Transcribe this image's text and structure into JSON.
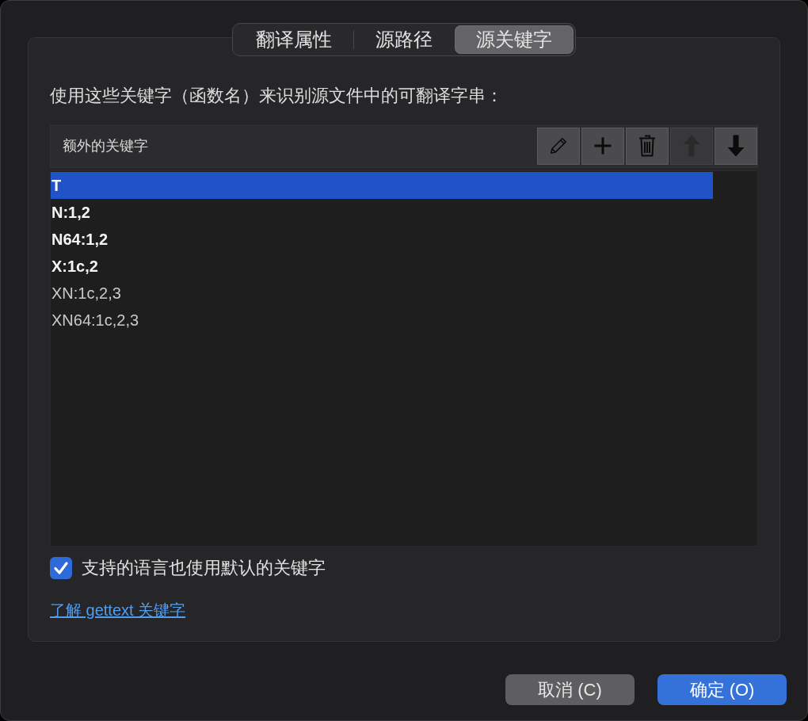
{
  "tabs": [
    {
      "label": "翻译属性",
      "selected": false
    },
    {
      "label": "源路径",
      "selected": false
    },
    {
      "label": "源关键字",
      "selected": true
    }
  ],
  "description": "使用这些关键字（函数名）来识别源文件中的可翻译字串：",
  "keyword_table": {
    "header": "额外的关键字",
    "toolbar": [
      {
        "kind": "edit",
        "disabled": false
      },
      {
        "kind": "add",
        "disabled": false
      },
      {
        "kind": "delete",
        "disabled": false
      },
      {
        "kind": "move_up",
        "disabled": true
      },
      {
        "kind": "move_down",
        "disabled": false
      }
    ],
    "rows": [
      {
        "text": "T",
        "selected": true,
        "bold": true
      },
      {
        "text": "N:1,2",
        "selected": false,
        "bold": true
      },
      {
        "text": "N64:1,2",
        "selected": false,
        "bold": true
      },
      {
        "text": "X:1c,2",
        "selected": false,
        "bold": true
      },
      {
        "text": "XN:1c,2,3",
        "selected": false,
        "bold": false
      },
      {
        "text": "XN64:1c,2,3",
        "selected": false,
        "bold": false
      }
    ]
  },
  "use_default_keywords": {
    "label": "支持的语言也使用默认的关键字",
    "checked": true
  },
  "link": "了解 gettext 关键字",
  "buttons": [
    {
      "label": "取消 (C)",
      "kind": "cancel"
    },
    {
      "label": "确定 (O)",
      "kind": "default"
    }
  ]
}
